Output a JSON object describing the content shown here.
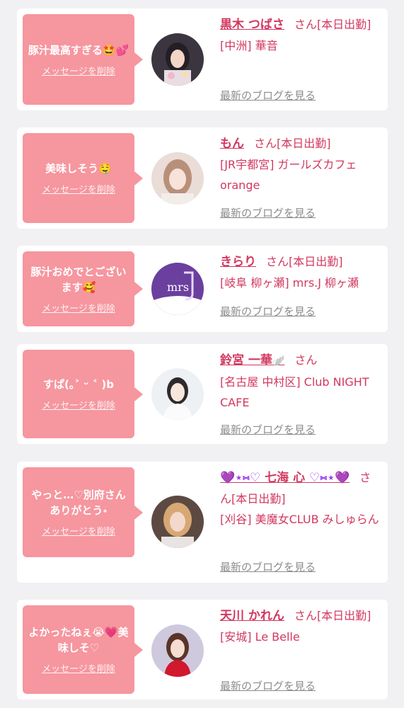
{
  "cards": [
    {
      "message": "豚汁最高すぎる🤩💕",
      "delete_label": "メッセージを削除",
      "avatar": "woman-in-kimono-photo",
      "name": "黒木 つばさ",
      "san": "さん",
      "status": "[本日出勤]",
      "shop": "[中洲] 華音",
      "blog_link": "最新のブログを見る"
    },
    {
      "message": "美味しそう🤤",
      "delete_label": "メッセージを削除",
      "avatar": "woman-portrait-photo",
      "name": "もん",
      "san": "さん",
      "status": "[本日出勤]",
      "shop": "[JR宇都宮] ガールズカフェ orange",
      "blog_link": "最新のブログを見る"
    },
    {
      "message": "豚汁おめでとございます🥰",
      "delete_label": "メッセージを削除",
      "avatar": "mrs-j-shop-logo",
      "avatar_text": "mrs",
      "name": "きらり",
      "san": "さん",
      "status": "[本日出勤]",
      "shop": "[岐阜 柳ヶ瀬] mrs.J 柳ヶ瀬",
      "blog_link": "最新のブログを見る"
    },
    {
      "message": "すぱ(｡˃ ᵕ ˂ )b",
      "delete_label": "メッセージを削除",
      "avatar": "woman-white-dress-photo",
      "name": "鈴宮 一華",
      "name_suffix": "🪽",
      "san": "さん",
      "status": "",
      "shop": "[名古屋 中村区] Club NIGHT CAFE",
      "blog_link": "最新のブログを見る"
    },
    {
      "message": "やっと…♡別府さんありがとう˖",
      "delete_label": "メッセージを削除",
      "avatar": "woman-blonde-photo",
      "name_prefix": "💜⋆⑅♡",
      "name": "七海 心",
      "name_suffix": "♡⑅⋆💜",
      "san": "さん",
      "status": "[本日出勤]",
      "shop": "[刈谷] 美魔女CLUB みしゅらん",
      "blog_link": "最新のブログを見る"
    },
    {
      "message": "よかったねぇ😭💗美味しそ♡",
      "delete_label": "メッセージを削除",
      "avatar": "woman-red-dress-photo",
      "name": "天川 かれん",
      "san": "さん",
      "status": "[本日出勤]",
      "shop": "[安城] Le Belle",
      "blog_link": "最新のブログを見る"
    }
  ],
  "colors": {
    "bubble": "#f6969f",
    "name": "#d2385f",
    "link": "#8c8c8c",
    "background": "#f1f1f3"
  }
}
